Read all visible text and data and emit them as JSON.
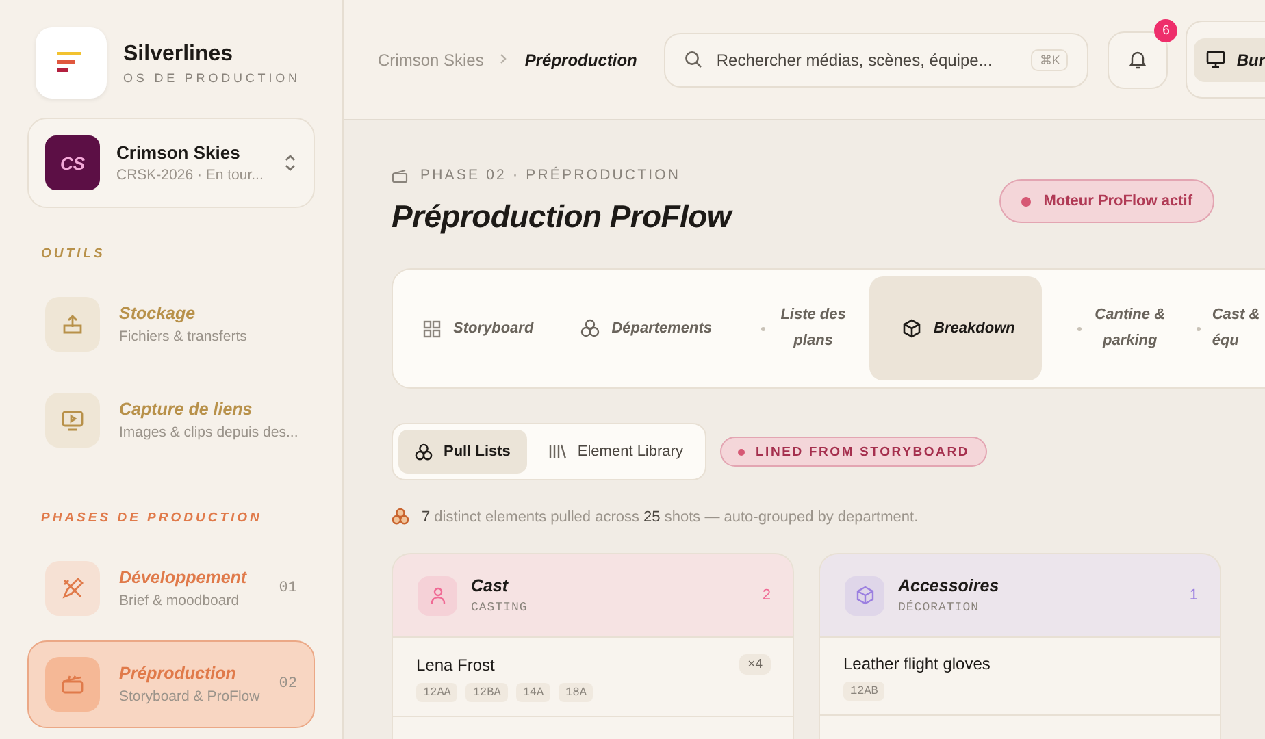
{
  "brand": {
    "name": "Silverlines",
    "tagline": "OS DE PRODUCTION"
  },
  "project": {
    "initials": "CS",
    "name": "Crimson Skies",
    "meta": "CRSK-2026 · En tour..."
  },
  "sidebar_sections": [
    {
      "kind": "tools",
      "title": "OUTILS",
      "items": [
        {
          "title": "Stockage",
          "subtitle": "Fichiers & transferts",
          "selected": false
        },
        {
          "title": "Capture de liens",
          "subtitle": "Images & clips depuis des...",
          "selected": false
        }
      ]
    },
    {
      "kind": "phases",
      "title": "PHASES DE PRODUCTION",
      "items": [
        {
          "title": "Développement",
          "subtitle": "Brief & moodboard",
          "number": "01",
          "selected": false
        },
        {
          "title": "Préproduction",
          "subtitle": "Storyboard & ProFlow",
          "number": "02",
          "selected": true
        }
      ]
    }
  ],
  "breadcrumb": [
    "Crimson Skies",
    "Préproduction"
  ],
  "search": {
    "placeholder": "Rechercher médias, scènes, équipe...",
    "shortcut": "⌘K"
  },
  "notifications": {
    "count": "6"
  },
  "workspace_button": {
    "label": "Bur"
  },
  "phase_label": "PHASE 02 · PRÉPRODUCTION",
  "page_title": "Préproduction ProFlow",
  "engine_status": {
    "label": "Moteur ProFlow actif",
    "on": true
  },
  "tabs": [
    {
      "label": "Storyboard",
      "kind": "icon",
      "selected": false
    },
    {
      "label": "Départements",
      "kind": "icon",
      "selected": false
    },
    {
      "label": "Liste des plans",
      "kind": "dot",
      "selected": false
    },
    {
      "label": "Breakdown",
      "kind": "icon",
      "selected": true
    },
    {
      "label": "Cantine & parking",
      "kind": "dot",
      "selected": false
    },
    {
      "label": "Cast & équ",
      "kind": "dot",
      "selected": false
    }
  ],
  "view_switch": [
    {
      "label": "Pull Lists",
      "selected": true
    },
    {
      "label": "Element Library",
      "selected": false
    }
  ],
  "source_badge": "LINED FROM STORYBOARD",
  "summary": "**7** distinct elements pulled across **25** shots — auto-grouped by department.",
  "departments": [
    {
      "name": "Cast",
      "category": "CASTING",
      "count": "2",
      "color": "#f06a95",
      "elements": [
        {
          "name": "Lena Frost",
          "uses": "×4",
          "shots": [
            "12AA",
            "12BA",
            "14A",
            "18A"
          ]
        }
      ]
    },
    {
      "name": "Accessoires",
      "category": "DÉCORATION",
      "count": "1",
      "color": "#9b7fe0",
      "elements": [
        {
          "name": "Leather flight gloves",
          "shots": [
            "12AB"
          ]
        }
      ]
    }
  ]
}
